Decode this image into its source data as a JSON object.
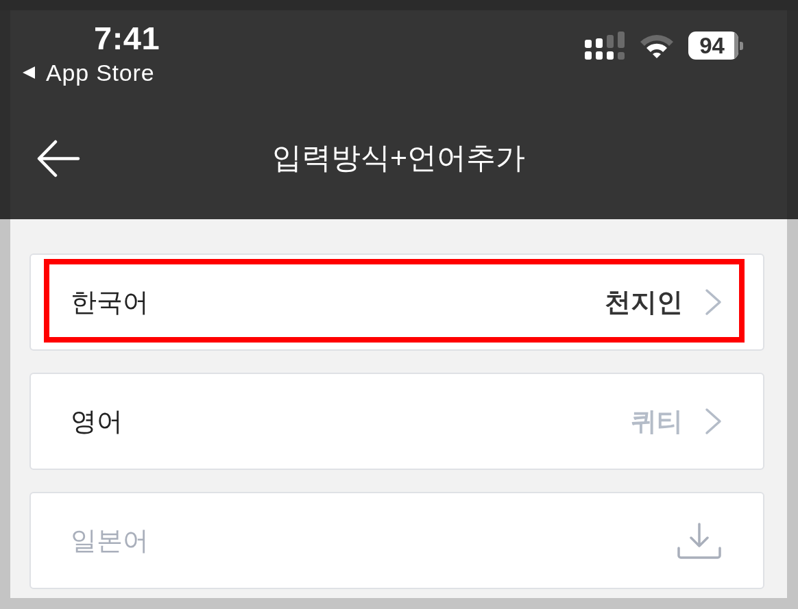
{
  "status_bar": {
    "time": "7:41",
    "back_app": "App Store",
    "battery": "94"
  },
  "header": {
    "title": "입력방식+언어추가"
  },
  "languages": [
    {
      "name": "한국어",
      "kind": "installed",
      "value": "천지인",
      "active": true,
      "highlighted": true
    },
    {
      "name": "영어",
      "kind": "installed",
      "value": "퀴티",
      "active": false,
      "highlighted": false
    },
    {
      "name": "일본어",
      "kind": "download",
      "highlighted": false
    }
  ]
}
